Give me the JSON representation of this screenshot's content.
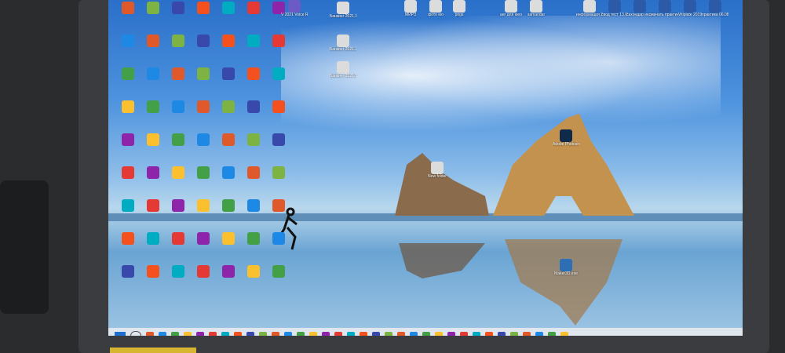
{
  "desktop": {
    "wallpaper": "windows-10-beach-rocks",
    "icons_col1": [
      "",
      "",
      "",
      "",
      "",
      "",
      "",
      "",
      ""
    ],
    "icons_named": [
      {
        "label": "V 2021 Voice Recorder",
        "icon": "app-icon",
        "color": "#6b5cc5"
      },
      {
        "label": "Банкинг 2021.1",
        "icon": "folder-icon",
        "color": "#dcdcdc"
      },
      {
        "label": "Банкинг 2021.2",
        "icon": "folder-icon",
        "color": "#dcdcdc"
      },
      {
        "label": "Банкинг 2021.3",
        "icon": "folder-icon",
        "color": "#dcdcdc"
      },
      {
        "label": "МИРЗ",
        "icon": "folder-icon",
        "color": "#dcdcdc"
      },
      {
        "label": "фото юо",
        "icon": "folder-icon",
        "color": "#dcdcdc"
      },
      {
        "label": "pngs",
        "icon": "folder-icon",
        "color": "#dcdcdc"
      },
      {
        "label": "анг для юео",
        "icon": "folder-icon",
        "color": "#dcdcdc"
      },
      {
        "label": "samandar",
        "icon": "folder-icon",
        "color": "#dcdcdc"
      },
      {
        "label": "информация 2021",
        "icon": "folder-icon",
        "color": "#dcdcdc"
      },
      {
        "label": "свод тест 13.09.21",
        "icon": "word-doc-icon",
        "color": "#2a5aa8"
      },
      {
        "label": "сахондар инсидар",
        "icon": "word-doc-icon",
        "color": "#2a5aa8"
      },
      {
        "label": "начать практика",
        "icon": "word-doc-icon",
        "color": "#2a5aa8"
      },
      {
        "label": "Vitiplate 2019",
        "icon": "word-doc-icon",
        "color": "#2a5aa8"
      },
      {
        "label": "практика 06.08.2021",
        "icon": "word-doc-icon",
        "color": "#2a5aa8"
      },
      {
        "label": "New folder",
        "icon": "folder-icon",
        "color": "#dcdcdc"
      },
      {
        "label": "Adobe Photosh...",
        "icon": "photoshop-icon",
        "color": "#0f2a4a"
      },
      {
        "label": "Maker3D.exe",
        "icon": "app-icon",
        "color": "#2d6fb5"
      }
    ]
  },
  "taskbar": {
    "apps": [
      "",
      "",
      "",
      "",
      "",
      "",
      "",
      "",
      "",
      "",
      "",
      "",
      "",
      "",
      "",
      "",
      "",
      "",
      "",
      "",
      "",
      "",
      "",
      "",
      "",
      "",
      "",
      "",
      "",
      "",
      "",
      "",
      "",
      ""
    ],
    "clock_time": "",
    "clock_date": ""
  }
}
